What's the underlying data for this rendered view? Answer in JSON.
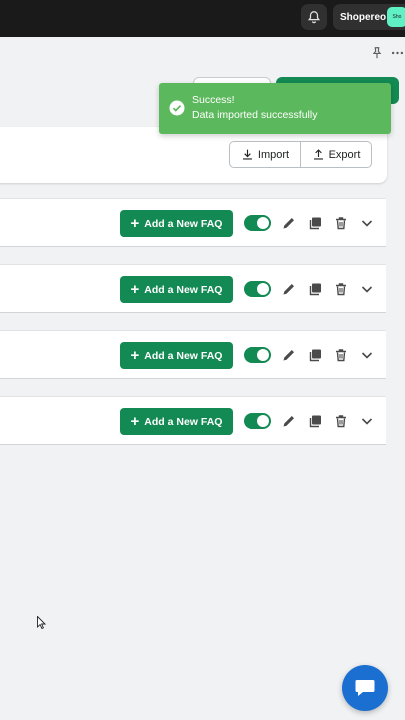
{
  "topbar": {
    "store_name": "Shopereo",
    "store_avatar_text": "Sho"
  },
  "toast": {
    "title": "Success!",
    "message": "Data imported successfully",
    "color": "#5cb85c"
  },
  "import_card": {
    "import_label": "Import",
    "export_label": "Export"
  },
  "faq_rows": [
    {
      "add_label": "Add a New FAQ",
      "enabled": true
    },
    {
      "add_label": "Add a New FAQ",
      "enabled": true
    },
    {
      "add_label": "Add a New FAQ",
      "enabled": true
    },
    {
      "add_label": "Add a New FAQ",
      "enabled": true
    }
  ],
  "colors": {
    "primary": "#138a53",
    "topbar": "#1a1a1a",
    "chat": "#1a6fd0"
  },
  "icons": [
    "bell-icon",
    "pin-icon",
    "more-icon",
    "check-circle-icon",
    "download-icon",
    "upload-icon",
    "plus-icon",
    "edit-icon",
    "duplicate-icon",
    "delete-icon",
    "chevron-down-icon",
    "chat-icon",
    "cursor-icon"
  ]
}
